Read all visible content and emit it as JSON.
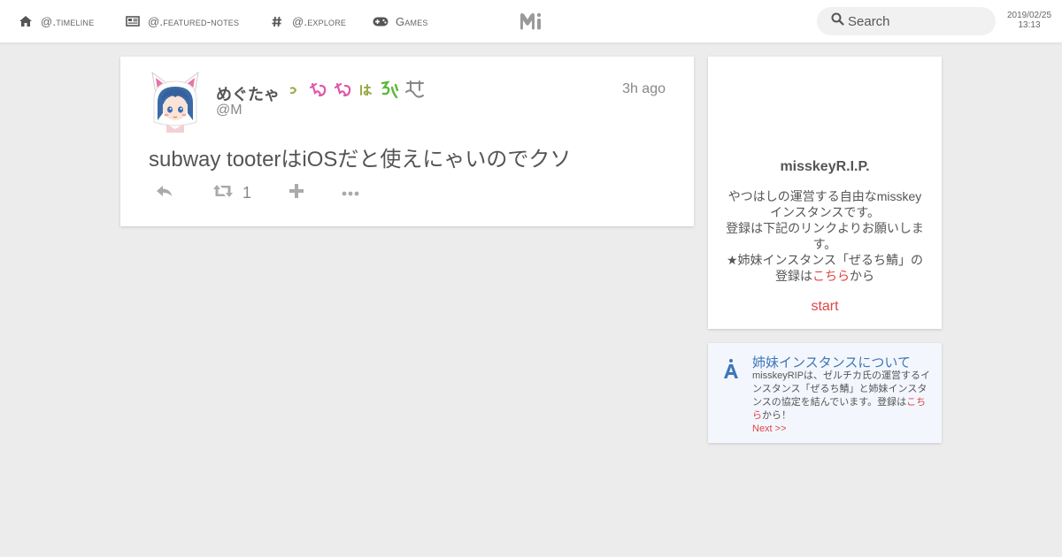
{
  "nav": {
    "timeline": "@.timeline",
    "featured_notes": "@.featured-notes",
    "explore": "@.explore",
    "games": "Games"
  },
  "search": {
    "placeholder": "Search"
  },
  "clock": {
    "date": "2019/02/25",
    "time": "13:13"
  },
  "post": {
    "display_name": "めぐたゃ",
    "handle": "@M",
    "time_ago": "3h ago",
    "text": "subway tooterはiOSだと使えにゃいのでクソ",
    "renote_count": "1"
  },
  "instance_card": {
    "title": "misskeyR.I.P.",
    "desc_line1": "やつはしの運営する自由なmisskeyインスタンスです。",
    "desc_line2": "登録は下記のリンクよりお願いします。",
    "desc_line3_prefix": "★姉妹インスタンス「ぜるち鯖」の登録は",
    "desc_link": "こちら",
    "desc_line3_suffix": "から",
    "start": "start"
  },
  "sister_card": {
    "title": "姉妹インスタンスについて",
    "body_prefix": "misskeyRIPは、ゼルチカ氏の運営するインスタンス「ぜるち鯖」と姉妹インスタンスの協定を結んでいます。登録は",
    "body_link": "こちら",
    "body_suffix": "から！",
    "next": "Next >>"
  },
  "colors": {
    "accent_red": "#e04545",
    "link_blue": "#3e76b8",
    "background": "#ececec"
  }
}
